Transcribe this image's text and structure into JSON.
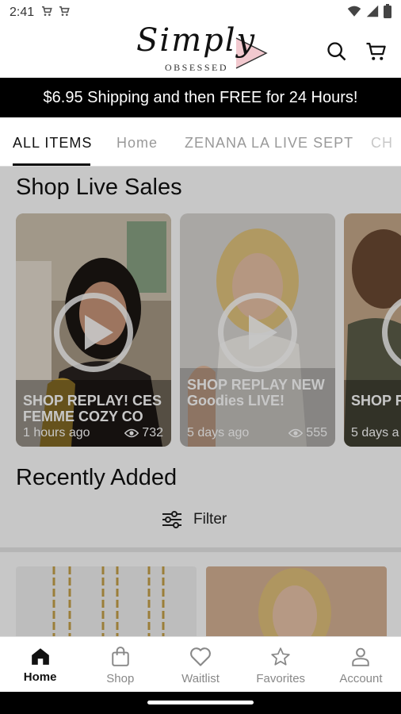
{
  "status_bar": {
    "time": "2:41",
    "left_icons": [
      "cart-icon",
      "cart-icon"
    ],
    "right_icons": [
      "wifi-icon",
      "signal-icon",
      "battery-icon"
    ]
  },
  "header": {
    "logo_script": "Simply",
    "logo_sub": "OBSESSED",
    "icons": [
      "search-icon",
      "cart-icon"
    ]
  },
  "banner": {
    "text": "$6.95 Shipping and then FREE for 24 Hours!"
  },
  "tabs": [
    {
      "label": "ALL ITEMS",
      "active": true
    },
    {
      "label": "Home",
      "active": false
    },
    {
      "label": "ZENANA LA LIVE SEPT",
      "active": false
    },
    {
      "label": "CH",
      "active": false
    }
  ],
  "live_sales": {
    "title": "Shop Live Sales",
    "cards": [
      {
        "title": "SHOP REPLAY! CES FEMME COZY CO",
        "time": "1 hours ago",
        "views": "732"
      },
      {
        "title": "SHOP REPLAY NEW Goodies LIVE!",
        "time": "5 days ago",
        "views": "555"
      },
      {
        "title": "SHOP R NEW S",
        "time": "5 days a",
        "views": ""
      }
    ]
  },
  "recently_added": {
    "title": "Recently Added",
    "filter_label": "Filter"
  },
  "bottom_nav": [
    {
      "label": "Home",
      "icon": "home-icon",
      "active": true
    },
    {
      "label": "Shop",
      "icon": "shopping-bag-icon",
      "active": false
    },
    {
      "label": "Waitlist",
      "icon": "heart-icon",
      "active": false
    },
    {
      "label": "Favorites",
      "icon": "star-icon",
      "active": false
    },
    {
      "label": "Account",
      "icon": "person-icon",
      "active": false
    }
  ],
  "colors": {
    "banner_bg": "#000000",
    "accent_pink": "#f2c9cf",
    "overlay": "rgba(0,0,0,0.22)"
  }
}
